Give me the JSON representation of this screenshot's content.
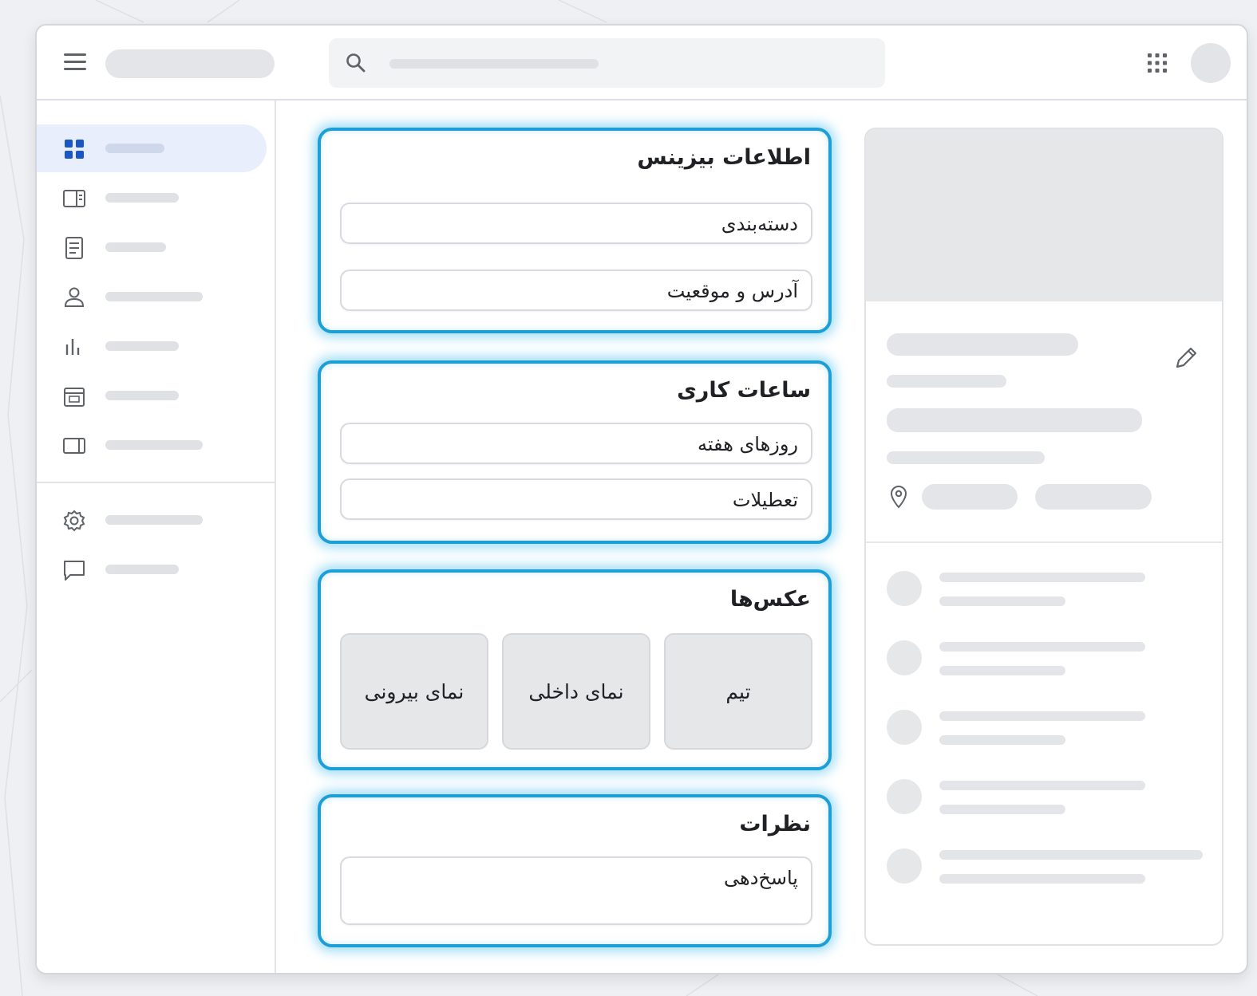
{
  "sections": {
    "business_info": {
      "title": "اطلاعات بیزینس",
      "fields": [
        "دسته‌بندی",
        "آدرس و موقعیت"
      ]
    },
    "working_hours": {
      "title": "ساعات کاری",
      "fields": [
        "روزهای هفته",
        "تعطیلات"
      ]
    },
    "photos": {
      "title": "عکس‌ها",
      "tiles": [
        "تیم",
        "نمای داخلی",
        "نمای بیرونی"
      ]
    },
    "reviews": {
      "title": "نظرات",
      "fields": [
        "پاسخ‌دهی"
      ]
    }
  },
  "icons": {
    "menu": "hamburger-menu-icon",
    "search": "search-icon",
    "apps": "apps-grid-icon",
    "sidebar": [
      "dashboard-icon",
      "layout-icon",
      "document-icon",
      "user-icon",
      "bar-chart-icon",
      "calendar-icon",
      "card-icon",
      "settings-icon",
      "chat-icon"
    ],
    "edit": "pencil-icon",
    "location": "location-pin-icon"
  },
  "colors": {
    "highlight_border": "#1d9fd6",
    "active_nav_bg": "#e8eefb",
    "active_icon": "#1a56c4",
    "placeholder": "#e3e5e8"
  }
}
